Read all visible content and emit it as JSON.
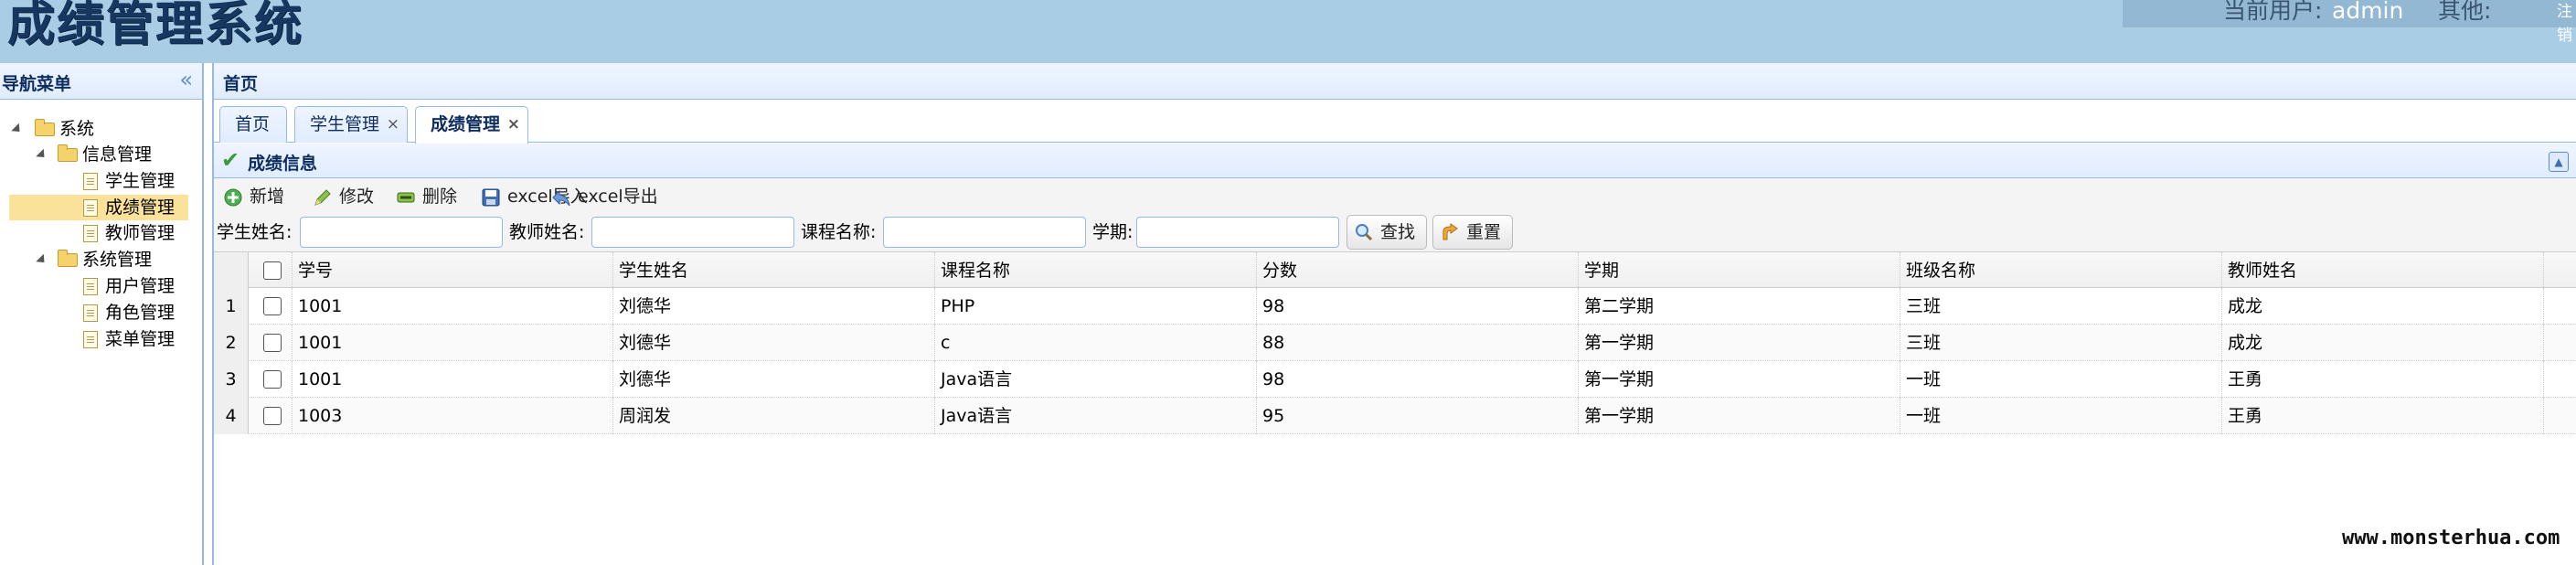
{
  "app": {
    "title": "成绩管理系统"
  },
  "user_bar": {
    "current_user_label": "当前用户:",
    "current_user": "admin",
    "other_label": "其他:",
    "logout": "注销"
  },
  "nav": {
    "title": "导航菜单",
    "tree": [
      {
        "label": "系统"
      },
      {
        "label": "信息管理"
      },
      {
        "label": "学生管理"
      },
      {
        "label": "成绩管理"
      },
      {
        "label": "教师管理"
      },
      {
        "label": "系统管理"
      },
      {
        "label": "用户管理"
      },
      {
        "label": "角色管理"
      },
      {
        "label": "菜单管理"
      }
    ]
  },
  "main": {
    "title": "首页",
    "tabs": [
      {
        "label": "首页"
      },
      {
        "label": "学生管理",
        "close": "×"
      },
      {
        "label": "成绩管理",
        "close": "×"
      }
    ],
    "section_title": "成绩信息",
    "toolbar": {
      "add": "新增",
      "edit": "修改",
      "delete": "删除",
      "import": "excel导入",
      "export": "excel导出"
    },
    "search": {
      "student_name_label": "学生姓名:",
      "teacher_name_label": "教师姓名:",
      "course_name_label": "课程名称:",
      "term_label": "学期:",
      "student_name_value": "",
      "teacher_name_value": "",
      "course_name_value": "",
      "term_value": "",
      "search_button": "查找",
      "reset_button": "重置"
    },
    "grid": {
      "columns": [
        "学号",
        "学生姓名",
        "课程名称",
        "分数",
        "学期",
        "班级名称",
        "教师姓名"
      ],
      "rows": [
        {
          "num": "1",
          "cells": [
            "1001",
            "刘德华",
            "PHP",
            "98",
            "第二学期",
            "三班",
            "成龙"
          ]
        },
        {
          "num": "2",
          "cells": [
            "1001",
            "刘德华",
            "c",
            "88",
            "第一学期",
            "三班",
            "成龙"
          ]
        },
        {
          "num": "3",
          "cells": [
            "1001",
            "刘德华",
            "Java语言",
            "98",
            "第一学期",
            "一班",
            "王勇"
          ]
        },
        {
          "num": "4",
          "cells": [
            "1003",
            "周润发",
            "Java语言",
            "95",
            "第一学期",
            "一班",
            "王勇"
          ]
        }
      ]
    }
  },
  "watermark": "www.monsterhua.com",
  "colors": {
    "header_bg": "#a9cde4",
    "panel_border": "#95b8e7",
    "selected_row": "#fbe29a",
    "title_text": "#16375f"
  }
}
